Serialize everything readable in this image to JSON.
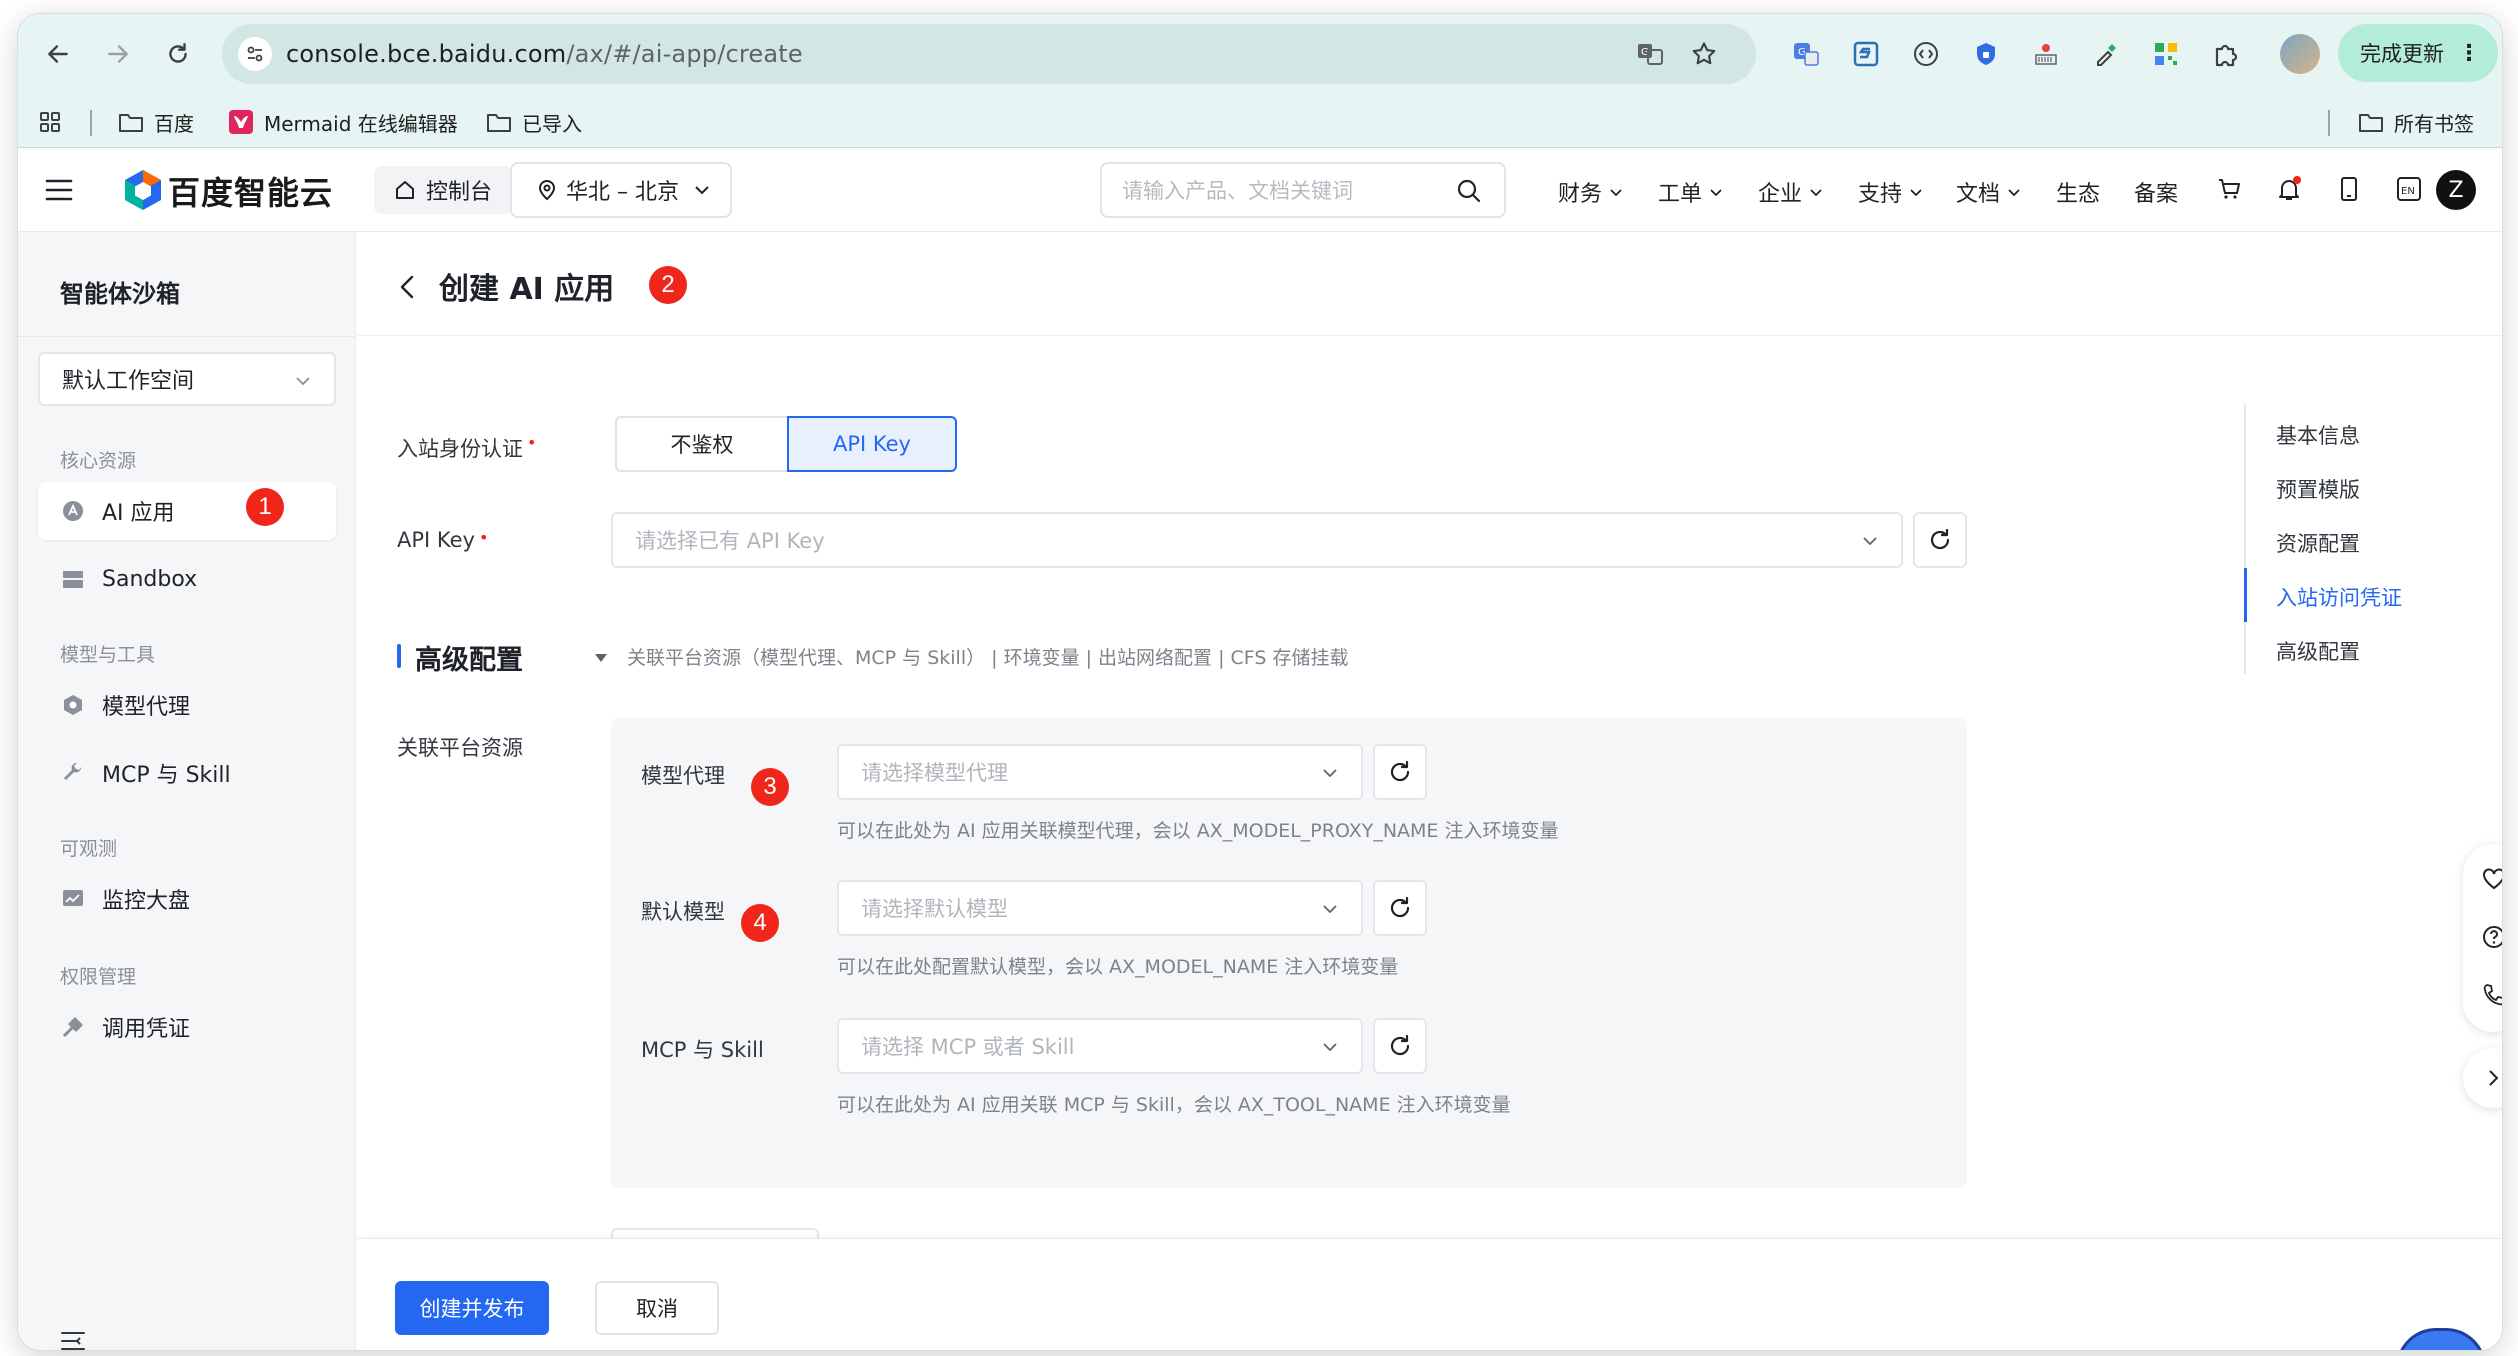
{
  "browser": {
    "url_host": "console.bce.baidu.com",
    "url_path": "/ax/#/ai-app/create",
    "update_label": "完成更新",
    "bookmarks": [
      "百度",
      "Mermaid 在线编辑器",
      "已导入"
    ],
    "all_bookmarks": "所有书签"
  },
  "topnav": {
    "brand": "百度智能云",
    "console": "控制台",
    "region": "华北 – 北京",
    "search_placeholder": "请输入产品、文档关键词",
    "links": [
      "财务",
      "工单",
      "企业",
      "支持",
      "文档",
      "生态",
      "备案"
    ],
    "avatar": "Z",
    "lang": "EN"
  },
  "sidebar": {
    "title": "智能体沙箱",
    "workspace": "默认工作空间",
    "groups": [
      "核心资源",
      "模型与工具",
      "可观测",
      "权限管理"
    ],
    "items": [
      "AI 应用",
      "Sandbox",
      "模型代理",
      "MCP 与 Skill",
      "监控大盘",
      "调用凭证"
    ]
  },
  "badges": [
    "1",
    "2",
    "3",
    "4"
  ],
  "page": {
    "title": "创建 AI 应用",
    "auth_label": "入站身份认证",
    "auth_options": [
      "不鉴权",
      "API Key"
    ],
    "apikey_label": "API Key",
    "apikey_placeholder": "请选择已有 API Key",
    "advanced_title": "高级配置",
    "advanced_desc": "关联平台资源（模型代理、MCP 与 Skill） | 环境变量 | 出站网络配置 | CFS 存储挂载",
    "resources_label": "关联平台资源",
    "model_proxy_label": "模型代理",
    "model_proxy_placeholder": "请选择模型代理",
    "model_proxy_hint": "可以在此处为 AI 应用关联模型代理，会以 AX_MODEL_PROXY_NAME 注入环境变量",
    "default_model_label": "默认模型",
    "default_model_placeholder": "请选择默认模型",
    "default_model_hint": "可以在此处配置默认模型，会以 AX_MODEL_NAME 注入环境变量",
    "mcp_label": "MCP 与 Skill",
    "mcp_placeholder": "请选择 MCP 或者 Skill",
    "mcp_hint": "可以在此处为 AI 应用关联 MCP 与 Skill，会以 AX_TOOL_NAME 注入环境变量",
    "submit": "创建并发布",
    "cancel": "取消"
  },
  "anchors": [
    "基本信息",
    "预置模版",
    "资源配置",
    "入站访问凭证",
    "高级配置"
  ],
  "colors": {
    "primary": "#2468f2",
    "badge": "#f0261b",
    "chrome": "#e6f4f3"
  }
}
